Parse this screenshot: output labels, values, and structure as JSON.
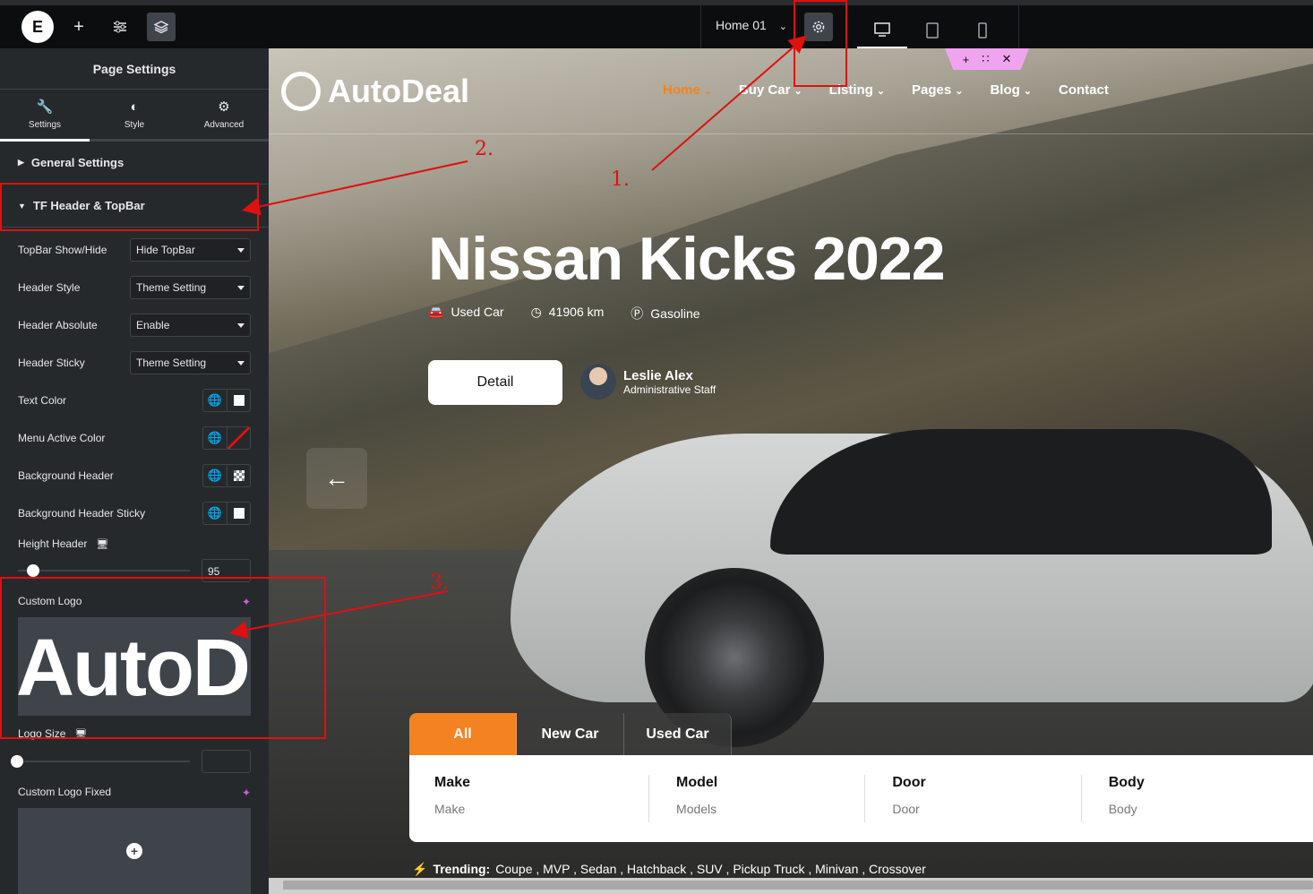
{
  "topbar": {
    "logo_letter": "E",
    "page_name": "Home 01",
    "tooltip_icons": [
      "plus-icon",
      "sliders-icon",
      "layers-icon"
    ]
  },
  "panel": {
    "title": "Page Settings",
    "tabs": [
      {
        "label": "Settings",
        "icon": "wrench-icon"
      },
      {
        "label": "Style",
        "icon": "half-circle-icon"
      },
      {
        "label": "Advanced",
        "icon": "gear-icon"
      }
    ],
    "sections": {
      "general": "General Settings",
      "header": "TF Header & TopBar"
    },
    "rows": {
      "topbar": {
        "label": "TopBar Show/Hide",
        "value": "Hide TopBar"
      },
      "header_style": {
        "label": "Header Style",
        "value": "Theme Setting"
      },
      "header_absolute": {
        "label": "Header Absolute",
        "value": "Enable"
      },
      "header_sticky": {
        "label": "Header Sticky",
        "value": "Theme Setting"
      },
      "text_color": {
        "label": "Text Color"
      },
      "menu_active_color": {
        "label": "Menu Active Color"
      },
      "bg_header": {
        "label": "Background Header"
      },
      "bg_header_sticky": {
        "label": "Background Header Sticky"
      },
      "height_header": {
        "label": "Height Header",
        "value": "95"
      },
      "custom_logo": {
        "label": "Custom Logo",
        "preview_text": "AutoD"
      },
      "logo_size": {
        "label": "Logo Size",
        "value": ""
      },
      "custom_logo_fixed": {
        "label": "Custom Logo Fixed"
      }
    }
  },
  "preview": {
    "brand": "AutoDeal",
    "nav": [
      {
        "label": "Home",
        "active": true,
        "dropdown": true
      },
      {
        "label": "Buy Car",
        "dropdown": true
      },
      {
        "label": "Listing",
        "dropdown": true
      },
      {
        "label": "Pages",
        "dropdown": true
      },
      {
        "label": "Blog",
        "dropdown": true
      },
      {
        "label": "Contact",
        "dropdown": false
      }
    ],
    "hero_title": "Nissan Kicks 2022",
    "specs": [
      {
        "icon": "car-icon",
        "text": "Used Car"
      },
      {
        "icon": "speedometer-icon",
        "text": "41906 km"
      },
      {
        "icon": "dollar-icon",
        "text": "Gasoline"
      }
    ],
    "detail_button": "Detail",
    "author": {
      "name": "Leslie Alex",
      "role": "Administrative Staff"
    },
    "tabs": [
      "All",
      "New Car",
      "Used Car"
    ],
    "filters": [
      {
        "label": "Make",
        "placeholder": "Make"
      },
      {
        "label": "Model",
        "placeholder": "Models"
      },
      {
        "label": "Door",
        "placeholder": "Door"
      },
      {
        "label": "Body",
        "placeholder": "Body"
      }
    ],
    "trending_label": "Trending:",
    "trending_items": "Coupe , MVP , Sedan , Hatchback , SUV , Pickup Truck , Minivan , Crossover"
  },
  "annotations": {
    "n1": "1.",
    "n2": "2.",
    "n3": "3."
  },
  "colors": {
    "accent": "#f58220",
    "annotation": "#e01010",
    "panel_bg": "#26292c"
  }
}
